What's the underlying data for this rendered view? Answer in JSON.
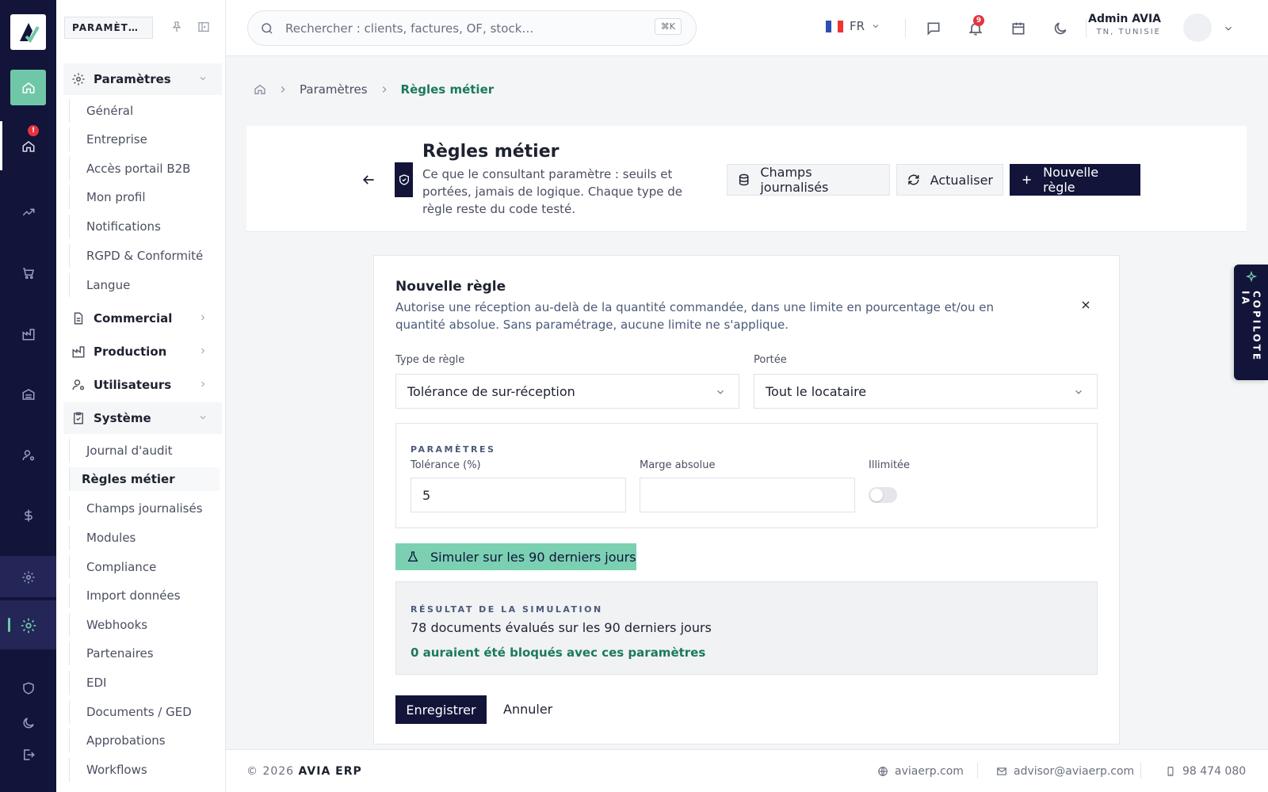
{
  "sidebar": {
    "workspace": "PARAMÈT…",
    "groups": {
      "parametres": "Paramètres",
      "commercial": "Commercial",
      "production": "Production",
      "utilisateurs": "Utilisateurs",
      "systeme": "Système"
    },
    "parametres_items": [
      "Général",
      "Entreprise",
      "Accès portail B2B",
      "Mon profil",
      "Notifications",
      "RGPD & Conformité",
      "Langue"
    ],
    "systeme_items": [
      "Journal d'audit",
      "Règles métier",
      "Champs journalisés",
      "Modules",
      "Compliance",
      "Import données",
      "Webhooks",
      "Partenaires",
      "EDI",
      "Documents / GED",
      "Approbations",
      "Workflows"
    ],
    "rail_badge": "!"
  },
  "topbar": {
    "search_placeholder": "Rechercher : clients, factures, OF, stock…",
    "search_shortcut": "⌘K",
    "language": "FR",
    "notif_count": "9",
    "user_name": "Admin AVIA",
    "user_country": "TN, TUNISIE"
  },
  "breadcrumb": {
    "parent": "Paramètres",
    "current": "Règles métier"
  },
  "header": {
    "title": "Règles métier",
    "description": "Ce que le consultant paramètre : seuils et portées, jamais de logique. Chaque type de règle reste du code testé.",
    "btn_fields": "Champs journalisés",
    "btn_refresh": "Actualiser",
    "btn_new": "Nouvelle règle"
  },
  "form": {
    "title": "Nouvelle règle",
    "description": "Autorise une réception au-delà de la quantité commandée, dans une limite en pourcentage et/ou en quantité absolue. Sans paramétrage, aucune limite ne s'applique.",
    "type_label": "Type de règle",
    "type_value": "Tolérance de sur-réception",
    "scope_label": "Portée",
    "scope_value": "Tout le locataire",
    "params_heading": "PARAMÈTRES",
    "tolerance_label": "Tolérance (%)",
    "tolerance_value": "5",
    "margin_label": "Marge absolue",
    "margin_value": "",
    "unlimited_label": "Illimitée",
    "simulate_label": "Simuler sur les 90 derniers jours",
    "result_heading": "RÉSULTAT DE LA SIMULATION",
    "result_line1": "78 documents évalués sur les 90 derniers jours",
    "result_line2": "0 auraient été bloqués avec ces paramètres",
    "save_label": "Enregistrer",
    "cancel_label": "Annuler"
  },
  "copilot": {
    "label": "COPILOTE IA"
  },
  "footer": {
    "copyright_prefix": "© 2026",
    "brand": "AVIA ERP",
    "website": "aviaerp.com",
    "email": "advisor@aviaerp.com",
    "phone": "98 474 080"
  },
  "colors": {
    "navy": "#12143a",
    "accent": "#6fc7a8",
    "success": "#1b7a5a",
    "danger": "#e53340"
  }
}
